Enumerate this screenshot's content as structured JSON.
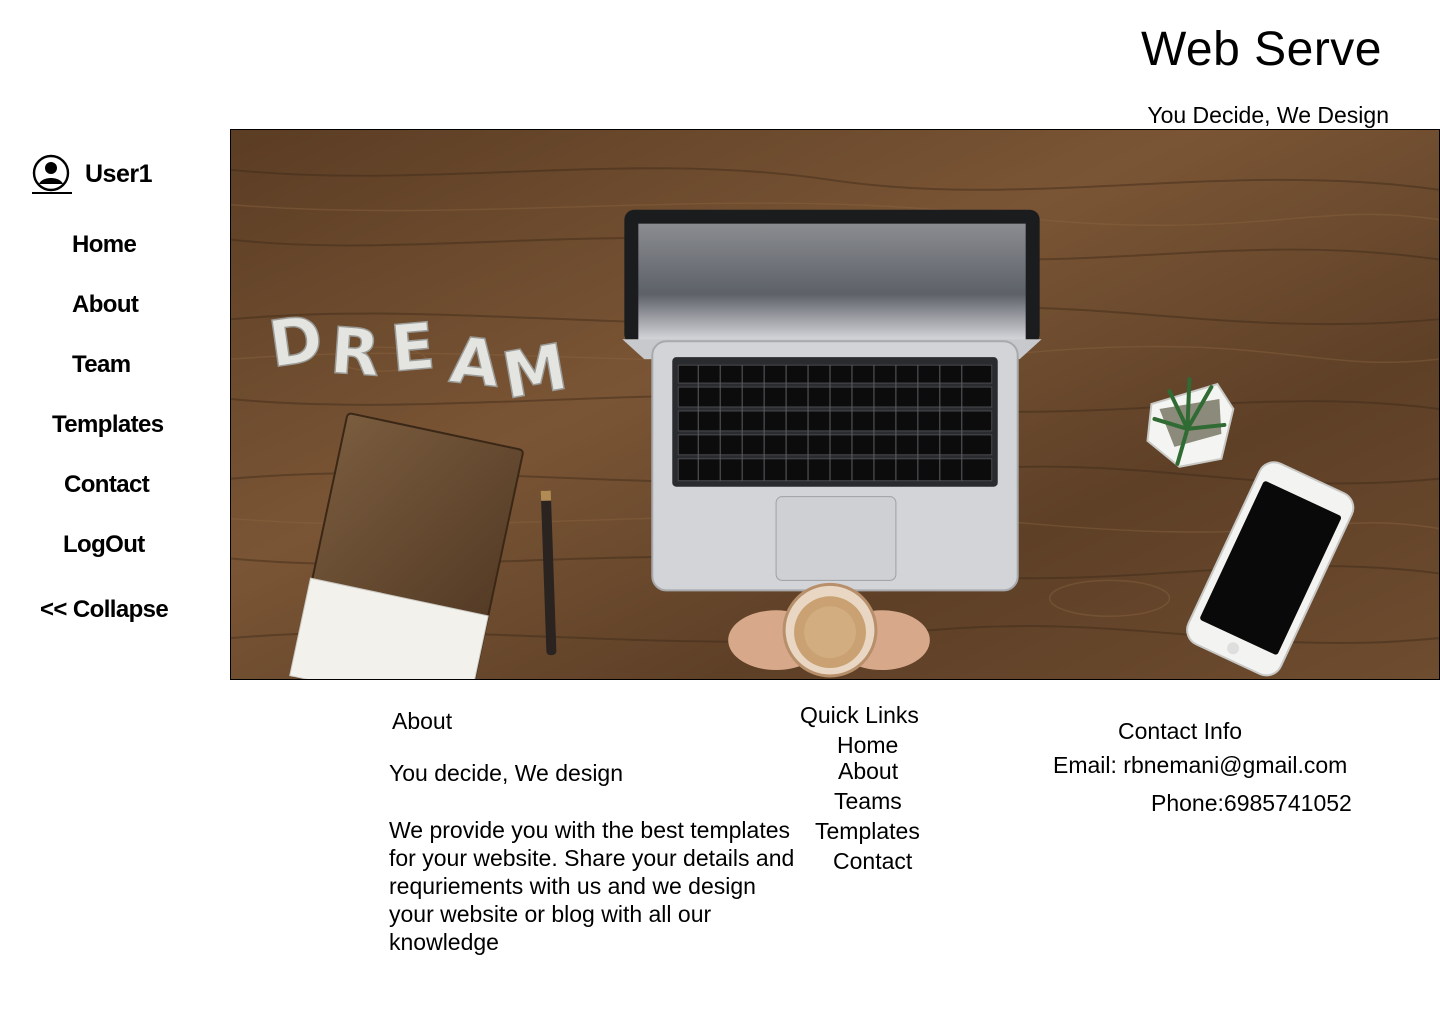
{
  "header": {
    "title": "Web Serve",
    "tagline": "You Decide, We Design"
  },
  "sidebar": {
    "user": {
      "icon": "user-circle-icon",
      "name": "User1"
    },
    "items": [
      {
        "label": "Home"
      },
      {
        "label": "About"
      },
      {
        "label": "Team"
      },
      {
        "label": "Templates"
      },
      {
        "label": "Contact"
      },
      {
        "label": "LogOut"
      },
      {
        "label": "<< Collapse"
      }
    ]
  },
  "hero": {
    "image_text": "DREAM"
  },
  "footer": {
    "about": {
      "heading": "About",
      "tagline": "You decide, We design",
      "body": "We provide you with the best templates for your website. Share your details and requriements with us and we design your website or blog with all our knowledge"
    },
    "quick_links": {
      "heading": "Quick Links",
      "links": [
        "Home",
        "About",
        "Teams",
        "Templates",
        "Contact"
      ]
    },
    "contact": {
      "heading": "Contact Info",
      "email": "Email: rbnemani@gmail.com",
      "phone": "Phone:6985741052"
    }
  },
  "colors": {
    "background": "#ffffff",
    "text": "#000000",
    "wood": "#6b4a2e"
  }
}
